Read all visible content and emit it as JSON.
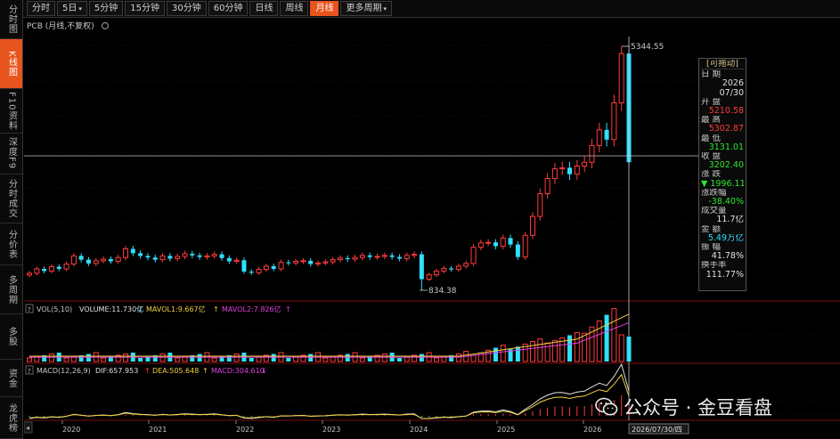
{
  "sidebar": {
    "items": [
      {
        "label": "分时图",
        "active": false
      },
      {
        "label": "K线图",
        "active": true
      },
      {
        "label": "F10资料",
        "active": false
      },
      {
        "label": "深度F9",
        "active": false
      },
      {
        "label": "分时成交",
        "active": false
      },
      {
        "label": "分价表",
        "active": false
      },
      {
        "label": "多周期",
        "active": false
      },
      {
        "label": "多股",
        "active": false
      },
      {
        "label": "资金",
        "active": false
      },
      {
        "label": "龙虎榜",
        "active": false
      }
    ]
  },
  "toolbar": {
    "items": [
      {
        "label": "分时",
        "active": false,
        "dropdown": false
      },
      {
        "label": "5日",
        "active": false,
        "dropdown": true
      },
      {
        "label": "5分钟",
        "active": false,
        "dropdown": false
      },
      {
        "label": "15分钟",
        "active": false,
        "dropdown": false
      },
      {
        "label": "30分钟",
        "active": false,
        "dropdown": false
      },
      {
        "label": "60分钟",
        "active": false,
        "dropdown": false
      },
      {
        "label": "日线",
        "active": false,
        "dropdown": false
      },
      {
        "label": "周线",
        "active": false,
        "dropdown": false
      },
      {
        "label": "月线",
        "active": true,
        "dropdown": false
      },
      {
        "label": "更多周期",
        "active": false,
        "dropdown": true
      }
    ]
  },
  "main_chart": {
    "title": "PCB (月线,不复权)",
    "high_marker": "5344.55",
    "low_marker": "834.38"
  },
  "vol_panel": {
    "qmark": "?",
    "name": "VOL(5,10)",
    "volume": "VOLUME:11.730亿",
    "mavol1": "MAVOL1:9.667亿",
    "mavol2": "MAVOL2:7.826亿"
  },
  "macd_panel": {
    "qmark": "?",
    "name": "MACD(12,26,9)",
    "dif": "DIF:657.953",
    "dea": "DEA:505.648",
    "macd": "MACD:304.610"
  },
  "xaxis": {
    "years": [
      "2020",
      "2021",
      "2022",
      "2023",
      "2024",
      "2025",
      "2026"
    ],
    "cursor_date": "2026/07/30/四"
  },
  "infobox": {
    "title": "[可拖动]",
    "date_label": "日  期",
    "date_year": "2026",
    "date_md": "07/30",
    "open_label": "开  盘",
    "open": "5210.58",
    "high_label": "最  高",
    "high": "5302.87",
    "low_label": "最  低",
    "low": "3131.01",
    "close_label": "收  盘",
    "close": "3202.40",
    "change_label": "涨  跌",
    "change": "▼ 1996.11",
    "pct_label": "涨跌幅",
    "pct": "-38.40%",
    "vol_label": "成交量",
    "vol": "11.7亿",
    "amount_label": "金  额",
    "amount": "5.49万亿",
    "amp_label": "振  幅",
    "amp": "41.78%",
    "turnover_label": "换手率",
    "turnover": "111.77%"
  },
  "watermark": {
    "text": "公众号 · 金豆看盘"
  },
  "colors": {
    "up": "#ff3c3c",
    "down": "#30e0ff",
    "active": "#e8541e"
  }
}
